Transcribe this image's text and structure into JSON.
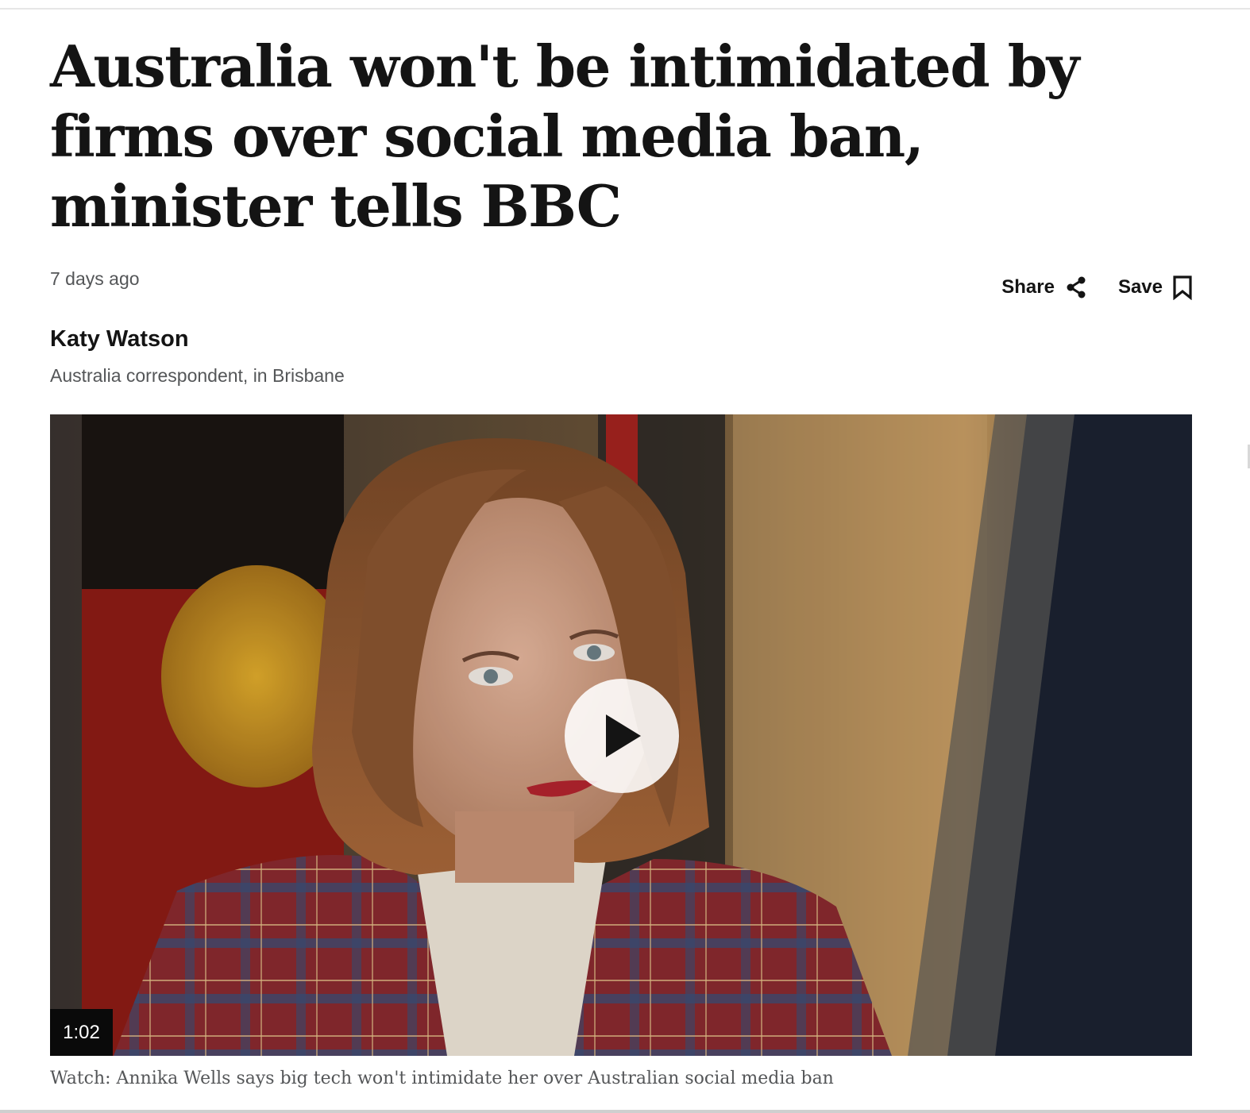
{
  "article": {
    "headline": "Australia won't be intimidated by firms over social media ban, minister tells BBC",
    "timestamp": "7 days ago",
    "share_label": "Share",
    "save_label": "Save",
    "author_name": "Katy Watson",
    "author_role": "Australia correspondent, in Brisbane"
  },
  "video": {
    "duration": "1:02",
    "caption": "Watch: Annika Wells says big tech won't intimidate her over Australian social media ban",
    "icons": {
      "play": "play-icon",
      "share": "share-icon",
      "save": "bookmark-icon"
    }
  }
}
